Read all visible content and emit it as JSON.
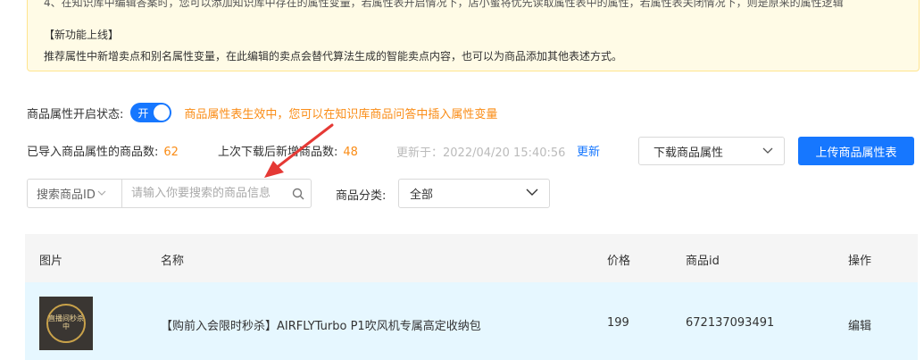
{
  "notice": {
    "line1": "4、在知识库中编辑答案时，您可以添加知识库中存在的属性变量，若属性表开启情况下，店小蜜将优先读取属性表中的属性，若属性表关闭情况下，则是原来的属性逻辑",
    "line2": "【新功能上线】",
    "line3": "推荐属性中新增卖点和别名属性变量，在此编辑的卖点会替代算法生成的智能卖点内容，也可以为商品添加其他表述方式。"
  },
  "status": {
    "label": "商品属性开启状态:",
    "switch_text": "开",
    "message": "商品属性表生效中，您可以在知识库商品问答中插入属性变量"
  },
  "stats": {
    "imported_label": "已导入商品属性的商品数:",
    "imported_count": "62",
    "new_label": "上次下载后新增商品数:",
    "new_count": "48",
    "updated_text": "更新于：2022/04/20 15:40:56",
    "refresh_link": "更新",
    "download_select": "下载商品属性",
    "upload_button": "上传商品属性表"
  },
  "search": {
    "type_label": "搜索商品ID",
    "placeholder": "请输入你要搜索的商品信息",
    "category_label": "商品分类:",
    "category_value": "全部"
  },
  "table": {
    "headers": [
      "图片",
      "名称",
      "价格",
      "商品id",
      "操作"
    ],
    "rows": [
      {
        "thumb_text": "直播间秒杀中",
        "name": "【购前入会限时秒杀】AIRFLYTurbo P1吹风机专属高定收纳包",
        "price": "199",
        "id": "672137093491",
        "action": "编辑"
      }
    ]
  },
  "colors": {
    "primary": "#1677ff",
    "warning": "#fa8c16",
    "annotation_arrow": "#e53935"
  }
}
